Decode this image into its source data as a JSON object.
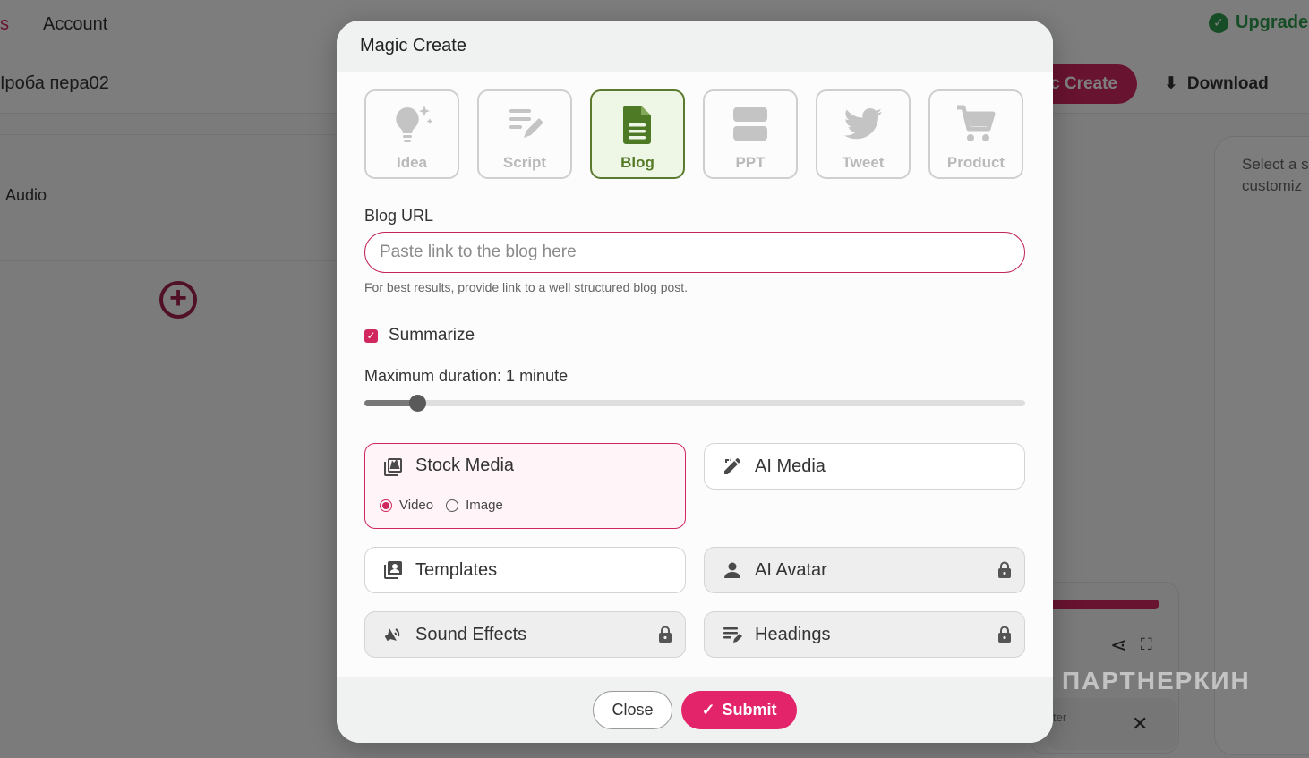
{
  "background": {
    "nav_fragment": "s",
    "nav_account": "Account",
    "upgrade_label": "Upgrade",
    "project_name": "Iроба пера02",
    "magic_create_label": "ic Create",
    "download_label": "Download",
    "audio_label": "Audio",
    "right_panel_text_1": "Select a s",
    "right_panel_text_2": "customiz",
    "mini_card_text": "ter",
    "watermark_text": "ПАРТНЕРКИН"
  },
  "modal": {
    "title": "Magic Create",
    "modes": [
      {
        "label": "Idea",
        "icon": "lightbulb-icon",
        "active": false
      },
      {
        "label": "Script",
        "icon": "script-icon",
        "active": false
      },
      {
        "label": "Blog",
        "icon": "blog-document-icon",
        "active": true
      },
      {
        "label": "PPT",
        "icon": "ppt-icon",
        "active": false
      },
      {
        "label": "Tweet",
        "icon": "twitter-bird-icon",
        "active": false
      },
      {
        "label": "Product",
        "icon": "shopping-cart-icon",
        "active": false
      }
    ],
    "blog_url_label": "Blog URL",
    "blog_url_value": "",
    "blog_url_placeholder": "Paste link to the blog here",
    "hint": "For best results, provide link to a well structured blog post.",
    "summarize_label": "Summarize",
    "summarize_checked": true,
    "duration_label": "Maximum duration: 1 minute",
    "duration_slider_fraction": 0.08,
    "options": {
      "stock_media": {
        "label": "Stock Media",
        "selected": true,
        "radio_video": "Video",
        "radio_image": "Image",
        "selected_media": "Video"
      },
      "ai_media": {
        "label": "AI Media",
        "locked": false
      },
      "templates": {
        "label": "Templates",
        "locked": false
      },
      "ai_avatar": {
        "label": "AI Avatar",
        "locked": true
      },
      "sound_effects": {
        "label": "Sound Effects",
        "locked": true
      },
      "headings": {
        "label": "Headings",
        "locked": true
      }
    },
    "close_label": "Close",
    "submit_label": "Submit"
  },
  "colors": {
    "accent": "#e3246a",
    "active_mode": "#5b7a2e",
    "upgrade_green": "#2e9b4c"
  }
}
